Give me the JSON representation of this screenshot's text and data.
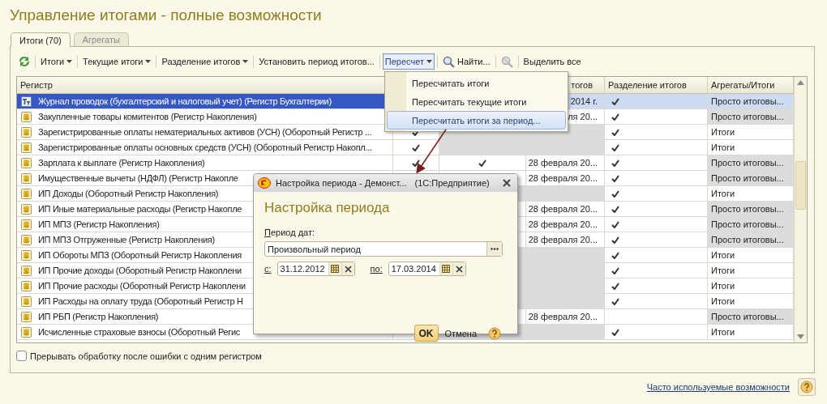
{
  "title": "Управление итогами - полные возможности",
  "tabs": [
    {
      "label": "Итоги (70)",
      "selected": true
    },
    {
      "label": "Агрегаты",
      "selected": false
    }
  ],
  "toolbar": [
    {
      "kind": "refresh"
    },
    {
      "kind": "dropdown",
      "label": "Итоги"
    },
    {
      "kind": "dropdown",
      "label": "Текущие итоги"
    },
    {
      "kind": "dropdown",
      "label": "Разделение итогов"
    },
    {
      "kind": "plain",
      "label": "Установить период итогов..."
    },
    {
      "kind": "dropdown",
      "label": "Пересчет",
      "pressed": true
    },
    {
      "kind": "search",
      "label": "Найти..."
    },
    {
      "kind": "disabled-icon"
    },
    {
      "kind": "plain",
      "label": "Выделить все"
    }
  ],
  "menu": {
    "items": [
      {
        "label": "Пересчитать итоги",
        "selected": false
      },
      {
        "label": "Пересчитать текущие итоги",
        "selected": false
      },
      {
        "label": "Пересчитать итоги за период...",
        "selected": true
      }
    ]
  },
  "table": {
    "headers": {
      "register": "Регистр",
      "column_4": "тогов",
      "split": "Разделение итогов",
      "aggregates": "Агрегаты/Итоги"
    },
    "rows": [
      {
        "kind": "accounting",
        "name": "Журнал проводок (бухгалтерский и налоговый учет) (Регистр Бухгалтерии)",
        "selected": true,
        "greyed": false,
        "column_4": "2014 г.",
        "split": true,
        "aggregates": "Просто итоговы..."
      },
      {
        "kind": "accumulation",
        "name": "Закупленные товары комитентов (Регистр Накопления)",
        "selected": false,
        "greyed": false,
        "column_4": "ля 20...",
        "split": true,
        "aggregates": "Просто итоговы..."
      },
      {
        "kind": "accumulation",
        "name": "Зарегистрированные оплаты нематериальных активов (УСН) (Оборотный Регистр ...",
        "selected": false,
        "greyed": true,
        "column_2": true,
        "split": true,
        "aggregates": "Итоги"
      },
      {
        "kind": "accumulation",
        "name": "Зарегистрированные оплаты основных средств (УСН) (Оборотный Регистр Накопл...",
        "selected": false,
        "greyed": true,
        "column_2": true,
        "split": true,
        "aggregates": "Итоги"
      },
      {
        "kind": "accumulation",
        "name": "Зарплата к выплате (Регистр Накопления)",
        "selected": false,
        "greyed": false,
        "column_2": true,
        "column_3": true,
        "column_4": "28 февраля 20...",
        "split": true,
        "aggregates": "Просто итоговы..."
      },
      {
        "kind": "accumulation",
        "name": "Имущественные вычеты (НДФЛ) (Регистр Накопле",
        "selected": false,
        "greyed": false,
        "column_4": "28 февраля 20...",
        "split": true,
        "aggregates": "Просто итоговы..."
      },
      {
        "kind": "accumulation",
        "name": "ИП Доходы (Оборотный Регистр Накопления)",
        "selected": false,
        "greyed": true,
        "split": true,
        "aggregates": "Итоги"
      },
      {
        "kind": "accumulation",
        "name": "ИП Иные материальные расходы (Регистр Накопле",
        "selected": false,
        "greyed": false,
        "column_4": "28 февраля 20...",
        "split": true,
        "aggregates": "Просто итоговы..."
      },
      {
        "kind": "accumulation",
        "name": "ИП МПЗ (Регистр Накопления)",
        "selected": false,
        "greyed": false,
        "column_4": "28 февраля 20...",
        "split": true,
        "aggregates": "Просто итоговы..."
      },
      {
        "kind": "accumulation",
        "name": "ИП МПЗ Отгруженные (Регистр Накопления)",
        "selected": false,
        "greyed": false,
        "column_4": "28 февраля 20...",
        "split": true,
        "aggregates": "Просто итоговы..."
      },
      {
        "kind": "accumulation",
        "name": "ИП Обороты МПЗ (Оборотный Регистр Накопления",
        "selected": false,
        "greyed": true,
        "split": true,
        "aggregates": "Итоги"
      },
      {
        "kind": "accumulation",
        "name": "ИП Прочие доходы (Оборотный Регистр Накоплени",
        "selected": false,
        "greyed": true,
        "split": true,
        "aggregates": "Итоги"
      },
      {
        "kind": "accumulation",
        "name": "ИП Прочие расходы (Оборотный Регистр Накоплени",
        "selected": false,
        "greyed": true,
        "split": true,
        "aggregates": "Итоги"
      },
      {
        "kind": "accumulation",
        "name": "ИП Расходы на оплату труда (Оборотный Регистр Н",
        "selected": false,
        "greyed": true,
        "split": true,
        "aggregates": "Итоги"
      },
      {
        "kind": "accumulation",
        "name": "ИП РБП (Регистр Накопления)",
        "selected": false,
        "greyed": false,
        "column_4": "28 февраля 20...",
        "split": false,
        "aggregates": "Просто итоговы..."
      },
      {
        "kind": "accumulation",
        "name": "Исчисленные страховые взносы (Оборотный Регис",
        "selected": false,
        "greyed": true,
        "split": true,
        "aggregates": "Итоги"
      }
    ]
  },
  "stop_on_error": {
    "label": "Прерывать обработку после ошибки с одним регистром",
    "checked": false
  },
  "footer_link": "Часто используемые возможности",
  "dialog": {
    "title": "Настройка периода - Демонст...",
    "app": "(1С:Предприятие)",
    "heading": "Настройка периода",
    "period_label": "Период дат:",
    "period_value": "Произвольный период",
    "from_label": "с:",
    "from_value": "31.12.2012",
    "to_label": "по:",
    "to_value": "17.03.2014",
    "ok": "OK",
    "cancel": "Отмена"
  }
}
